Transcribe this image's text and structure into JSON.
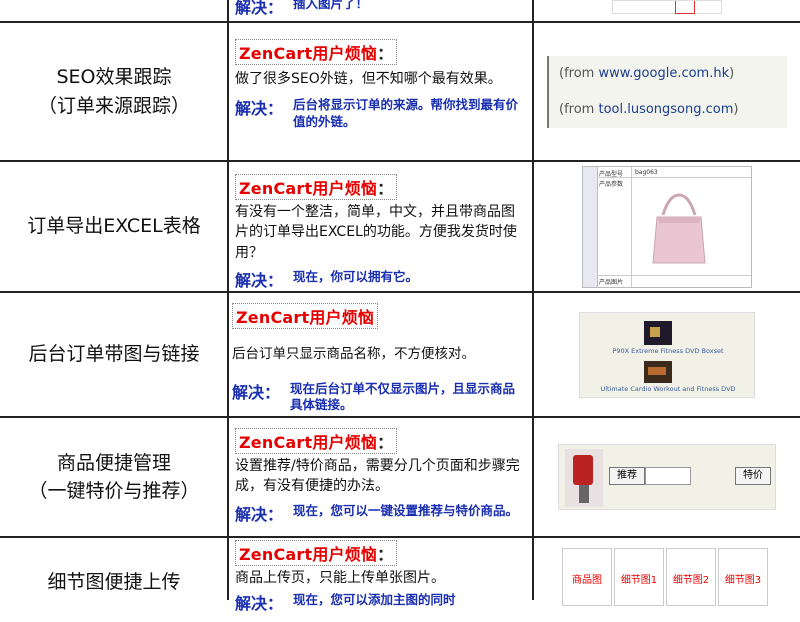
{
  "rows": [
    {
      "id": "row0",
      "solution_label": "解决：",
      "solution": "插入图片了！"
    },
    {
      "id": "row1",
      "title": [
        "SEO效果跟踪",
        "（订单来源跟踪）"
      ],
      "trouble": "ZenCart用户烦恼",
      "trouble_colon": "：",
      "problem": "做了很多SEO外链，但不知哪个最有效果。",
      "solution_label": "解决：",
      "solution": "后台将显示订单的来源。帮你找到最有价值的外链。",
      "sources": [
        {
          "prefix": "(from ",
          "domain": "www.google.com.hk",
          "suffix": ")"
        },
        {
          "prefix": "(from ",
          "domain": "tool.lusongsong.com",
          "suffix": ")"
        }
      ]
    },
    {
      "id": "row2",
      "title": [
        "订单导出EXCEL表格"
      ],
      "trouble": "ZenCart用户烦恼",
      "trouble_colon": "：",
      "problem": "有没有一个整洁，简单，中文，并且带商品图片的订单导出EXCEL的功能。方便我发货时使用？",
      "solution_label": "解决：",
      "solution": "现在，你可以拥有它。",
      "excel_cells": [
        "产品型号",
        "产品参数",
        "产品图片"
      ],
      "excel_value": "bag063"
    },
    {
      "id": "row3",
      "title": [
        "后台订单带图与链接"
      ],
      "trouble": "ZenCart用户烦恼",
      "trouble_colon": "",
      "problem": "后台订单只显示商品名称，不方便核对。",
      "solution_label": "解决：",
      "solution": "现在后台订单不仅显示图片，且显示商品具体链接。",
      "products": [
        "P90X Extreme Fitness DVD Boxset",
        "Ultimate Cardio Workout and Fitness DVD"
      ]
    },
    {
      "id": "row4",
      "title": [
        "商品便捷管理",
        "（一键特价与推荐）"
      ],
      "trouble": "ZenCart用户烦恼",
      "trouble_colon": "：",
      "problem": "设置推荐/特价商品，需要分几个页面和步骤完成，有没有便捷的办法。",
      "solution_label": "解决：",
      "solution": "现在，您可以一键设置推荐与特价商品。",
      "buttons": [
        "推荐",
        "特价"
      ]
    },
    {
      "id": "row5",
      "title": [
        "细节图便捷上传"
      ],
      "trouble": "ZenCart用户烦恼",
      "trouble_colon": "：",
      "problem": "商品上传页，只能上传单张图片。",
      "solution_label": "解决：",
      "solution": "现在，您可以添加主图的同时",
      "thumbs": [
        "商品图",
        "细节图1",
        "细节图2",
        "细节图3"
      ]
    }
  ],
  "colors": {
    "trouble": "#e60000",
    "solution": "#1a2fb0",
    "border": "#222222"
  }
}
